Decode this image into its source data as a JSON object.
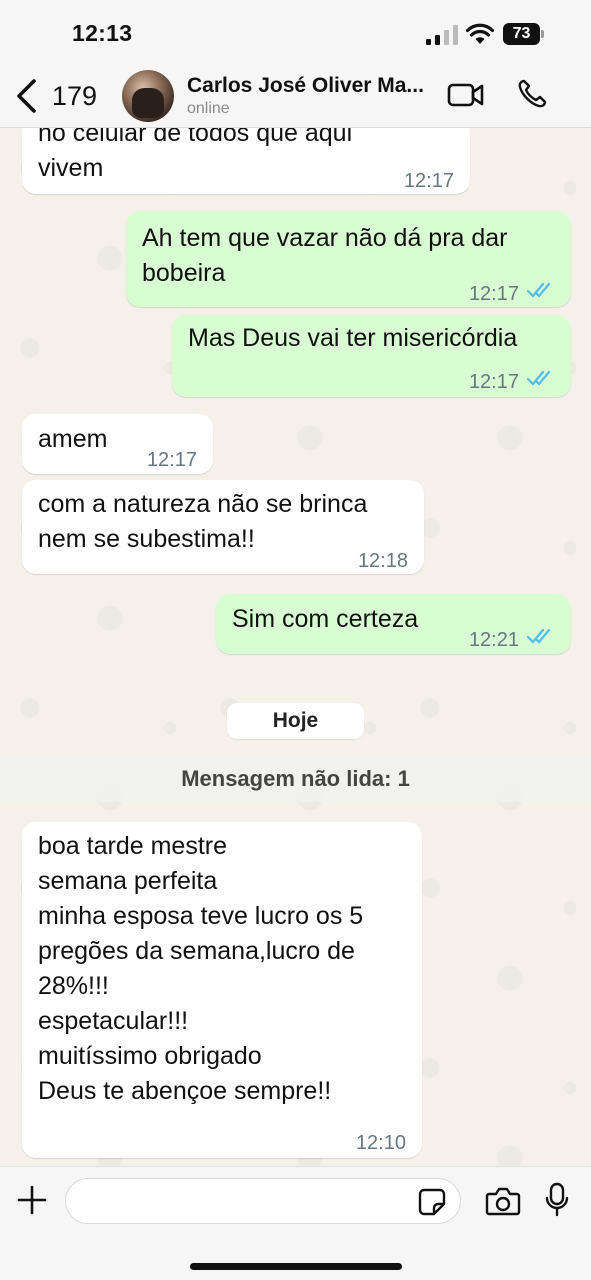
{
  "status_bar": {
    "time": "12:13",
    "battery_level": "73",
    "icons": [
      "signal-icon",
      "wifi-icon",
      "battery-icon"
    ]
  },
  "header": {
    "back_count": "179",
    "contact_name": "Carlos José Oliver Ma...",
    "contact_status": "online",
    "icons": [
      "chevron-left-icon",
      "video-call-icon",
      "phone-icon"
    ]
  },
  "messages": [
    {
      "direction": "in",
      "text": "no celular de todos que aqui\nvivem",
      "time": "12:17"
    },
    {
      "direction": "out",
      "text": "Ah tem que vazar não dá pra dar\nbobeira",
      "time": "12:17",
      "status": "read"
    },
    {
      "direction": "out",
      "text": "Mas Deus vai ter misericórdia",
      "time": "12:17",
      "status": "read"
    },
    {
      "direction": "in",
      "text": "amem",
      "time": "12:17"
    },
    {
      "direction": "in",
      "text": "com a natureza não se brinca\nnem se subestima!!",
      "time": "12:18"
    },
    {
      "direction": "out",
      "text": "Sim com certeza",
      "time": "12:21",
      "status": "read"
    },
    {
      "direction": "in",
      "text": "boa tarde mestre\nsemana perfeita\nminha esposa teve lucro os 5\npregões da semana,lucro de\n28%!!!\nespetacular!!!\nmuitíssimo obrigado\nDeus te abençoe sempre!!",
      "time": "12:10"
    }
  ],
  "day_separator": "Hoje",
  "unread_banner": "Mensagem não lida: 1",
  "input_bar": {
    "placeholder": "",
    "icons": [
      "plus-icon",
      "sticker-icon",
      "camera-icon",
      "microphone-icon"
    ]
  },
  "colors": {
    "incoming_bubble": "#ffffff",
    "outgoing_bubble": "#d9fdd3",
    "read_ticks": "#53bdeb",
    "timestamp": "#667781",
    "chat_background": "#f5f1ea"
  }
}
